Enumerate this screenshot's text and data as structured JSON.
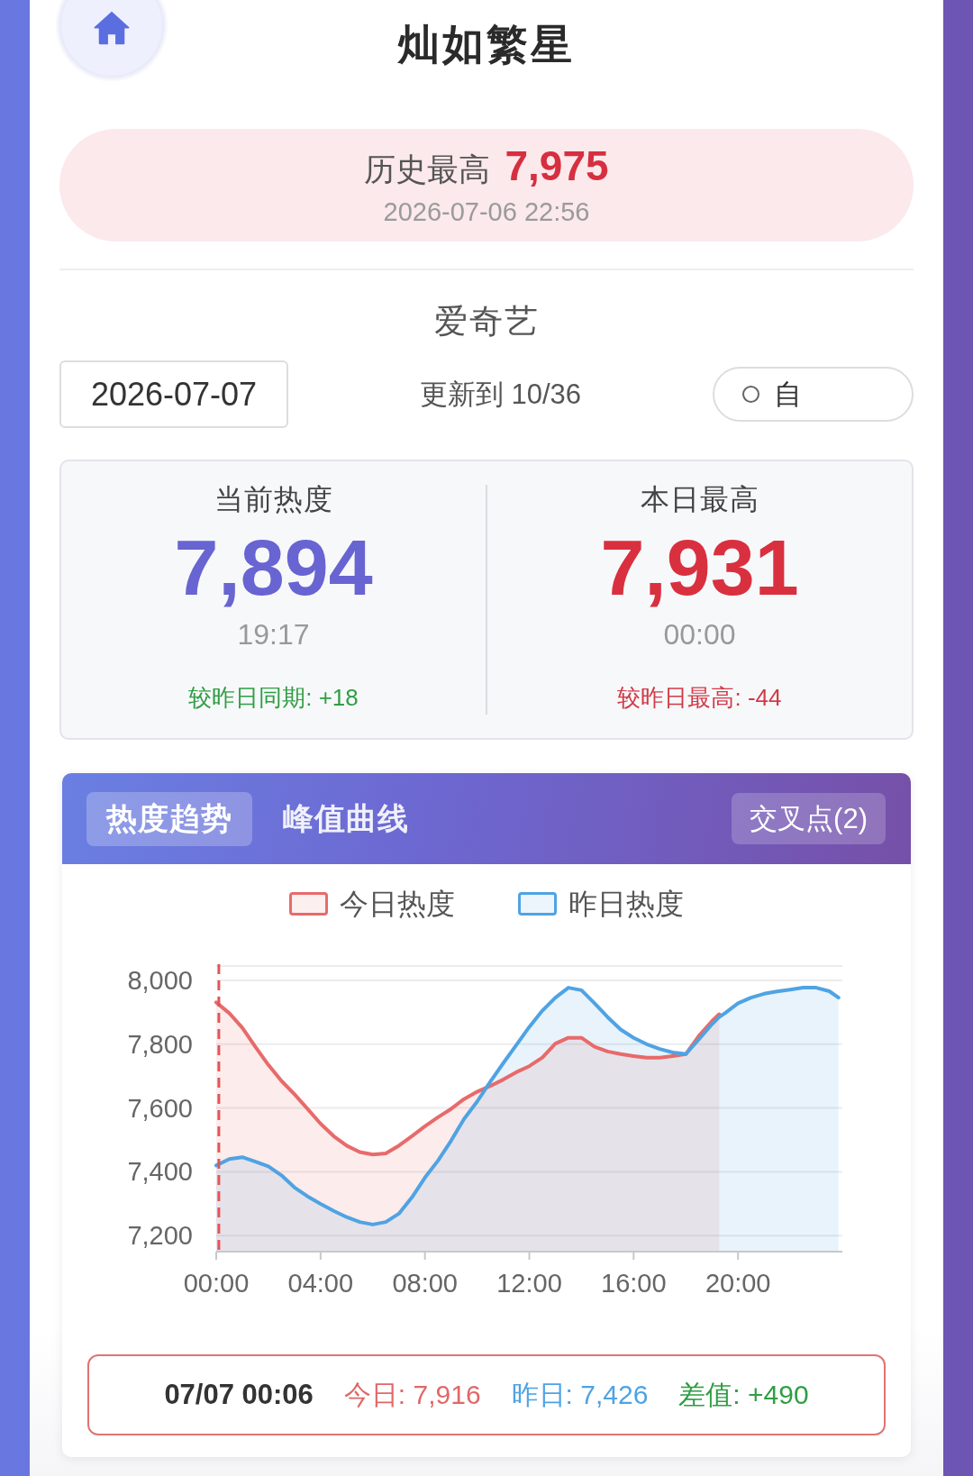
{
  "header": {
    "title": "灿如繁星"
  },
  "record": {
    "label": "历史最高",
    "value": "7,975",
    "time": "2026-07-06 22:56"
  },
  "platform": "爱奇艺",
  "controls": {
    "date": "2026-07-07",
    "update_status": "更新到 10/36",
    "toggle": {
      "label": "自",
      "on": false
    }
  },
  "stats": [
    {
      "label": "当前热度",
      "value": "7,894",
      "time": "19:17",
      "color": "#6864d2",
      "comparison": {
        "text": "较昨日同期: +18",
        "color": "#2f9e44"
      }
    },
    {
      "label": "本日最高",
      "value": "7,931",
      "time": "00:00",
      "color": "#d9303f",
      "comparison": {
        "text": "较昨日最高: -44",
        "color": "#d23a48"
      }
    }
  ],
  "chart_panel": {
    "tabs": [
      {
        "label": "热度趋势",
        "selected": true
      },
      {
        "label": "峰值曲线",
        "selected": false
      }
    ],
    "action": "交叉点(2)",
    "chart_data": {
      "type": "area",
      "x": [
        0,
        0.5,
        1,
        1.5,
        2,
        2.5,
        3,
        3.5,
        4,
        4.5,
        5,
        5.5,
        6,
        6.5,
        7,
        7.5,
        8,
        8.5,
        9,
        9.5,
        10,
        10.5,
        11,
        11.5,
        12,
        12.5,
        13,
        13.5,
        14,
        14.5,
        15,
        15.5,
        16,
        16.5,
        17,
        17.5,
        18,
        18.5,
        19,
        19.28,
        19.5,
        20,
        20.5,
        21,
        21.5,
        22,
        22.5,
        23,
        23.5,
        23.85
      ],
      "xlim": [
        0,
        24
      ],
      "ylim": [
        7150,
        8045
      ],
      "xticks": [
        {
          "value": 0,
          "label": "00:00"
        },
        {
          "value": 4,
          "label": "04:00"
        },
        {
          "value": 8,
          "label": "08:00"
        },
        {
          "value": 12,
          "label": "12:00"
        },
        {
          "value": 16,
          "label": "16:00"
        },
        {
          "value": 20,
          "label": "20:00"
        }
      ],
      "yticks": [
        {
          "value": 7200,
          "label": "7,200"
        },
        {
          "value": 7400,
          "label": "7,400"
        },
        {
          "value": 7600,
          "label": "7,600"
        },
        {
          "value": 7800,
          "label": "7,800"
        },
        {
          "value": 8000,
          "label": "8,000"
        }
      ],
      "grid": true,
      "stacked": false,
      "series": [
        {
          "name": "今日热度",
          "color": "#e86a6a",
          "values": [
            7931,
            7897,
            7851,
            7792,
            7735,
            7685,
            7643,
            7597,
            7551,
            7512,
            7482,
            7462,
            7454,
            7458,
            7482,
            7512,
            7543,
            7571,
            7597,
            7628,
            7651,
            7669,
            7689,
            7712,
            7731,
            7758,
            7802,
            7820,
            7820,
            7792,
            7777,
            7769,
            7763,
            7758,
            7758,
            7763,
            7769,
            7826,
            7872,
            7894,
            null,
            null,
            null,
            null,
            null,
            null,
            null,
            null,
            null,
            null
          ]
        },
        {
          "name": "昨日热度",
          "color": "#4fa3e3",
          "values": [
            7420,
            7440,
            7446,
            7432,
            7417,
            7389,
            7351,
            7323,
            7300,
            7278,
            7258,
            7243,
            7235,
            7243,
            7269,
            7320,
            7382,
            7435,
            7497,
            7566,
            7620,
            7682,
            7740,
            7797,
            7854,
            7905,
            7946,
            7977,
            7969,
            7928,
            7885,
            7846,
            7820,
            7800,
            7785,
            7774,
            7769,
            7815,
            7862,
            7885,
            7897,
            7928,
            7946,
            7958,
            7965,
            7971,
            7977,
            7977,
            7966,
            7946
          ]
        }
      ],
      "ref_lines": [
        {
          "axis": "x",
          "value": 0.1,
          "color": "#e05656"
        }
      ]
    },
    "tooltip": {
      "time": "07/07 00:06",
      "items": [
        {
          "text": "今日: 7,916",
          "color": "#e06868"
        },
        {
          "text": "昨日: 7,426",
          "color": "#4fa3e3"
        },
        {
          "text": "差值: +490",
          "color": "#2f9e44"
        }
      ]
    }
  }
}
